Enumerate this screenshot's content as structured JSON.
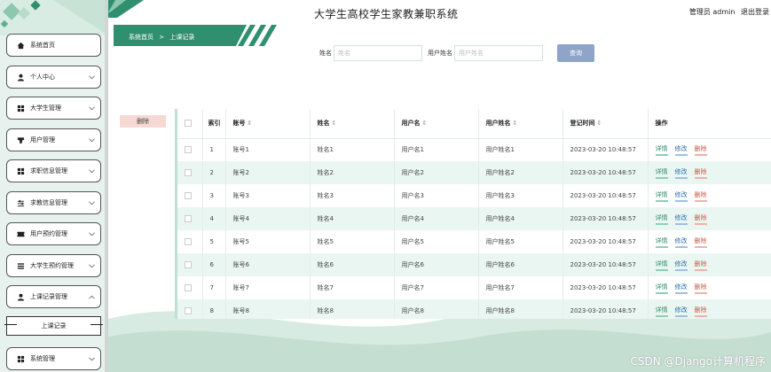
{
  "header": {
    "title": "大学生高校学生家教兼职系统",
    "user_label": "管理员 admin",
    "logout_label": "退出登录"
  },
  "breadcrumb": {
    "home": "系统首页",
    "separator": ">",
    "current": "上课记录"
  },
  "search": {
    "name_label": "姓名",
    "name_placeholder": "姓名",
    "username_label": "用户姓名",
    "username_placeholder": "用户姓名",
    "button_label": "查询"
  },
  "actions": {
    "delete_label": "删除"
  },
  "sidebar": {
    "items": [
      {
        "label": "系统首页",
        "icon": "home-icon",
        "chevron": false
      },
      {
        "label": "个人中心",
        "icon": "person-icon",
        "chevron": true
      },
      {
        "label": "大学生管理",
        "icon": "grid-icon",
        "chevron": true
      },
      {
        "label": "用户管理",
        "icon": "cup-icon",
        "chevron": true
      },
      {
        "label": "求职信息管理",
        "icon": "grid-icon",
        "chevron": true
      },
      {
        "label": "求教信息管理",
        "icon": "sliders-icon",
        "chevron": true
      },
      {
        "label": "用户预约管理",
        "icon": "ticket-icon",
        "chevron": true
      },
      {
        "label": "大学生预约管理",
        "icon": "list-icon",
        "chevron": true
      },
      {
        "label": "上课记录管理",
        "icon": "person-icon",
        "chevron": "up"
      },
      {
        "label": "系统管理",
        "icon": "grid-icon",
        "chevron": true
      }
    ],
    "sub_item": "上课记录"
  },
  "table": {
    "columns": [
      "",
      "索引",
      "账号",
      "姓名",
      "用户名",
      "用户姓名",
      "登记时间",
      "操作"
    ],
    "rows": [
      [
        "1",
        "账号1",
        "姓名1",
        "用户名1",
        "用户姓名1",
        "2023-03-20 10:48:57"
      ],
      [
        "2",
        "账号2",
        "姓名2",
        "用户名2",
        "用户姓名2",
        "2023-03-20 10:48:57"
      ],
      [
        "3",
        "账号3",
        "姓名3",
        "用户名3",
        "用户姓名3",
        "2023-03-20 10:48:57"
      ],
      [
        "4",
        "账号4",
        "姓名4",
        "用户名4",
        "用户姓名4",
        "2023-03-20 10:48:57"
      ],
      [
        "5",
        "账号5",
        "姓名5",
        "用户名5",
        "用户姓名5",
        "2023-03-20 10:48:57"
      ],
      [
        "6",
        "账号6",
        "姓名6",
        "用户名6",
        "用户姓名6",
        "2023-03-20 10:48:57"
      ],
      [
        "7",
        "账号7",
        "姓名7",
        "用户名7",
        "用户姓名7",
        "2023-03-20 10:48:57"
      ],
      [
        "8",
        "账号8",
        "姓名8",
        "用户名8",
        "用户姓名8",
        "2023-03-20 10:48:57"
      ]
    ],
    "row_actions": {
      "detail": "详情",
      "edit": "修改",
      "delete": "删除"
    }
  },
  "watermark": "CSDN @Django计算机程序",
  "colors": {
    "accent": "#2f8f6f",
    "sidebar_bg": "#e7f2ee",
    "row_stripe": "#eaf6f1",
    "search_button": "#8ea4c8",
    "delete_button": "#f6d9d3"
  }
}
